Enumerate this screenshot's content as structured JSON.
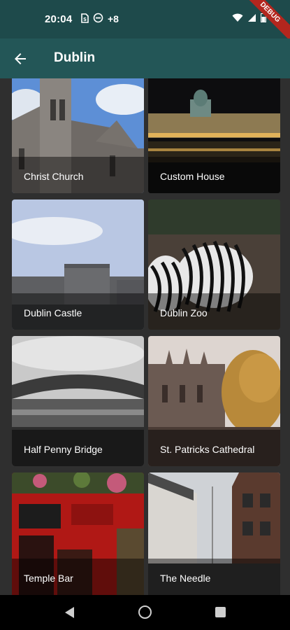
{
  "status_bar": {
    "time": "20:04",
    "extra_notifications": "+8",
    "debug_label": "DEBUG"
  },
  "app_bar": {
    "title": "Dublin"
  },
  "places": [
    {
      "name": "Christ Church"
    },
    {
      "name": "Custom House"
    },
    {
      "name": "Dublin Castle"
    },
    {
      "name": "Dublin Zoo"
    },
    {
      "name": "Half Penny Bridge"
    },
    {
      "name": "St. Patricks Cathedral"
    },
    {
      "name": "Temple Bar"
    },
    {
      "name": "The Needle"
    }
  ],
  "icons": {
    "back": "arrow-back-icon",
    "wifi": "wifi-icon",
    "signal": "signal-icon",
    "battery": "battery-icon"
  }
}
